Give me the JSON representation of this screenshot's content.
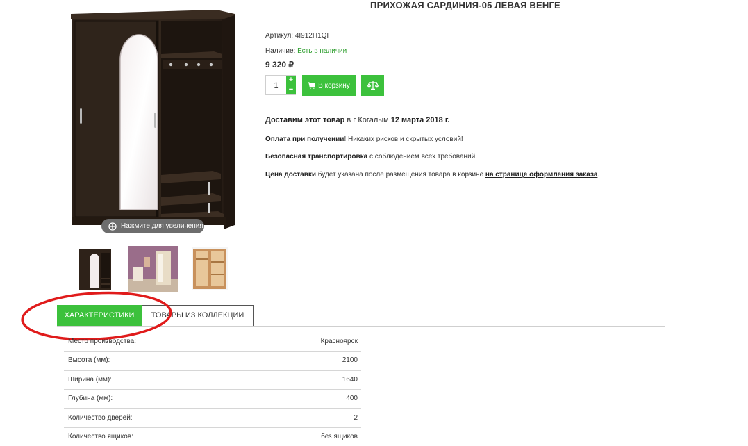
{
  "product": {
    "title": "ПРИХОЖАЯ САРДИНИЯ-05 ЛЕВАЯ ВЕНГЕ",
    "sku_label": "Артикул:",
    "sku_value": "4I912H1QI",
    "stock_label": "Наличие:",
    "stock_value": "Есть в наличии",
    "price": "9 320 ₽",
    "quantity": "1"
  },
  "gallery": {
    "zoom_hint": "Нажмите для увеличения",
    "thumbnail_count": 3
  },
  "actions": {
    "plus_label": "+",
    "minus_label": "−",
    "cart_label": "В корзину",
    "cart_icon": "shopping-cart-icon",
    "compare_icon": "scales-icon"
  },
  "delivery": {
    "line1_bold1": "Доставим этот товар",
    "line1_text": " в г Когалым ",
    "line1_bold2": "12 марта 2018 г.",
    "line2_bold": "Оплата при получении",
    "line2_text": "! Никаких рисков и скрытых условий!",
    "line3_bold": "Безопасная транспортировка",
    "line3_text": " с соблюдением всех требований.",
    "line4_bold": "Цена доставки",
    "line4_text": " будет указана после размещения товара в корзине ",
    "line4_link": "на странице оформления заказа",
    "line4_end": "."
  },
  "tabs": [
    {
      "label": "ХАРАКТЕРИСТИКИ",
      "active": true
    },
    {
      "label": "ТОВАРЫ ИЗ КОЛЛЕКЦИИ",
      "active": false
    }
  ],
  "specs": [
    {
      "label": "Место производства:",
      "value": "Красноярск"
    },
    {
      "label": "Высота (мм):",
      "value": "2100"
    },
    {
      "label": "Ширина (мм):",
      "value": "1640"
    },
    {
      "label": "Глубина (мм):",
      "value": "400"
    },
    {
      "label": "Количество дверей:",
      "value": "2"
    },
    {
      "label": "Количество ящиков:",
      "value": "без ящиков"
    }
  ],
  "colors": {
    "accent_green": "#3cc13c",
    "in_stock_green": "#2e9e2e",
    "annotation_red": "#e01b1b",
    "wenge_dark": "#2e2219"
  }
}
